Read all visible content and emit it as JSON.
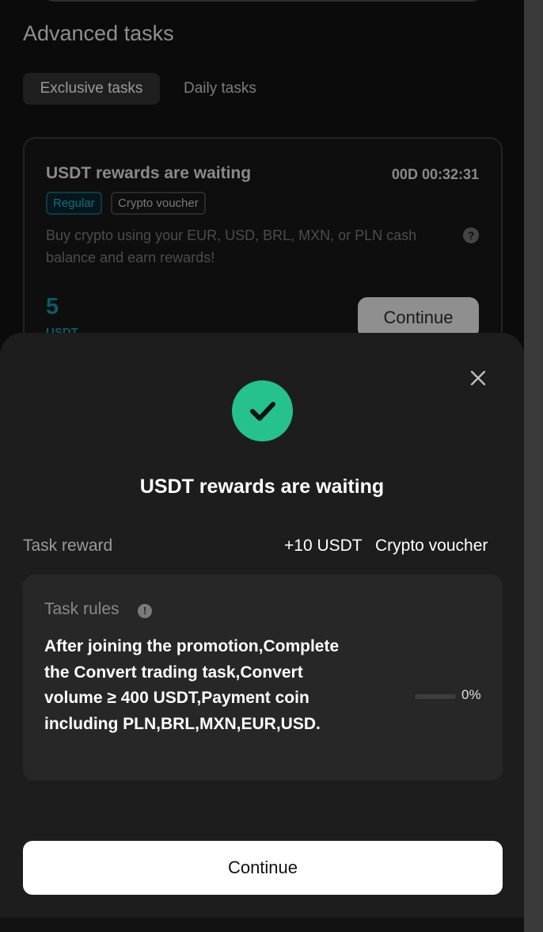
{
  "section": {
    "title": "Advanced tasks"
  },
  "tabs": [
    {
      "label": "Exclusive tasks",
      "active": true
    },
    {
      "label": "Daily tasks",
      "active": false
    }
  ],
  "task_card": {
    "title": "USDT rewards are waiting",
    "timer": "00D 00:32:31",
    "tags": [
      "Regular",
      "Crypto voucher"
    ],
    "description": "Buy crypto using your EUR, USD, BRL, MXN, or PLN cash balance and earn rewards!",
    "help_icon": "question-circle-icon",
    "reward_amount": "5",
    "reward_unit": "USDT",
    "continue_label": "Continue"
  },
  "sheet": {
    "close_icon": "close-icon",
    "status_icon": "check-circle-icon",
    "title": "USDT rewards are waiting",
    "reward": {
      "label": "Task reward",
      "value": "+10 USDT",
      "type": "Crypto voucher"
    },
    "rules": {
      "label": "Task rules",
      "info_icon": "info-circle-icon",
      "text": "After joining the promotion,Complete the Convert trading task,Convert volume ≥ 400 USDT,Payment coin including PLN,BRL,MXN,EUR,USD.",
      "progress_percent": 0,
      "progress_label": "0%"
    },
    "continue_label": "Continue"
  },
  "colors": {
    "accent_green": "#25c28d",
    "tag_teal": "#0f6f82",
    "sheet_bg": "#1d1d1d",
    "page_bg": "#0b0b0b"
  }
}
